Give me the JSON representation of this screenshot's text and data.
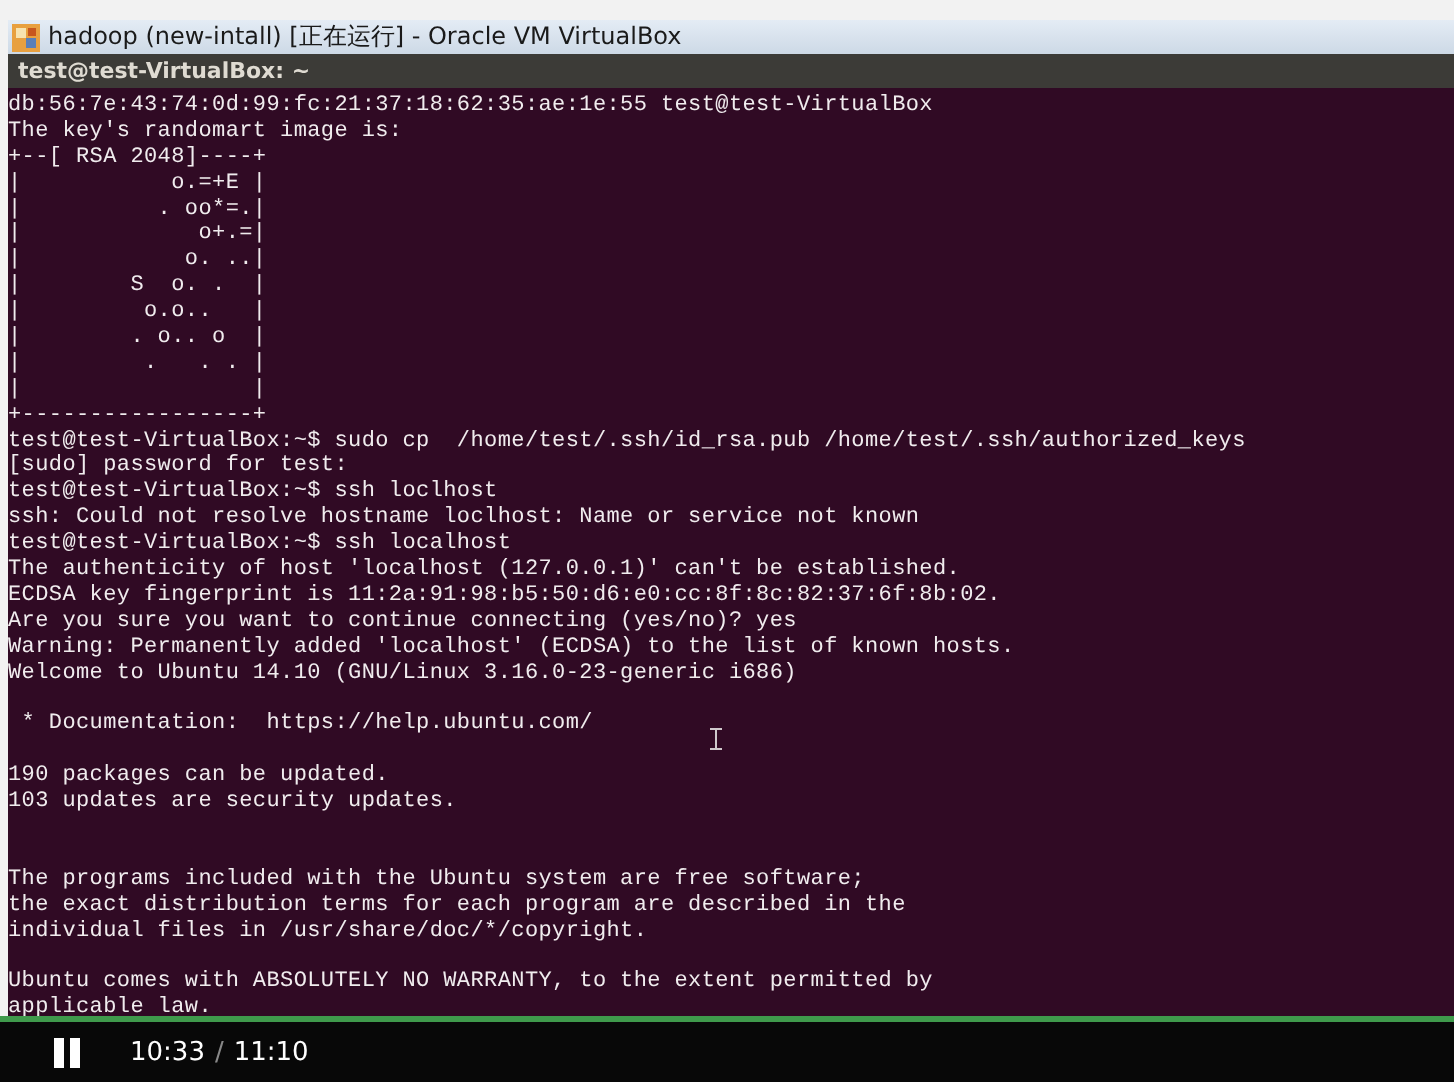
{
  "window": {
    "title": "hadoop (new-intall) [正在运行] - Oracle VM VirtualBox"
  },
  "terminal": {
    "title": "test@test-VirtualBox: ~",
    "lines": [
      {
        "text": "db:56:7e:43:74:0d:99:fc:21:37:18:62:35:ae:1e:55 test@test-VirtualBox"
      },
      {
        "text": "The key's randomart image is:"
      },
      {
        "text": "+--[ RSA 2048]----+"
      },
      {
        "text": "|           o.=+E |"
      },
      {
        "text": "|          . oo*=.|"
      },
      {
        "text": "|             o+.=|"
      },
      {
        "text": "|            o. ..|"
      },
      {
        "text": "|        S  o. .  |"
      },
      {
        "text": "|         o.o..   |"
      },
      {
        "text": "|        . o.. o  |"
      },
      {
        "text": "|         .   . . |"
      },
      {
        "text": "|                 |"
      },
      {
        "text": "+-----------------+"
      },
      {
        "text": "test@test-VirtualBox:~$ sudo cp  /home/test/.ssh/id_rsa.pub /home/test/.ssh/authorized_keys"
      },
      {
        "text": "[sudo] password for test:"
      },
      {
        "text": "test@test-VirtualBox:~$ ssh loclhost"
      },
      {
        "text": "ssh: Could not resolve hostname loclhost: Name or service not known"
      },
      {
        "text": "test@test-VirtualBox:~$ ssh localhost"
      },
      {
        "text": "The authenticity of host 'localhost (127.0.0.1)' can't be established."
      },
      {
        "text": "ECDSA key fingerprint is 11:2a:91:98:b5:50:d6:e0:cc:8f:8c:82:37:6f:8b:02."
      },
      {
        "text": "Are you sure you want to continue connecting (yes/no)? yes"
      },
      {
        "text": "Warning: Permanently added 'localhost' (ECDSA) to the list of known hosts."
      },
      {
        "text": "Welcome to Ubuntu 14.10 (GNU/Linux 3.16.0-23-generic i686)"
      },
      {
        "kind": "blank"
      },
      {
        "text": " * Documentation:  https://help.ubuntu.com/"
      },
      {
        "kind": "blank"
      },
      {
        "text": "190 packages can be updated."
      },
      {
        "text": "103 updates are security updates."
      },
      {
        "kind": "blank"
      },
      {
        "kind": "blank"
      },
      {
        "text": "The programs included with the Ubuntu system are free software;"
      },
      {
        "text": "the exact distribution terms for each program are described in the"
      },
      {
        "text": "individual files in /usr/share/doc/*/copyright."
      },
      {
        "kind": "blank"
      },
      {
        "text": "Ubuntu comes with ABSOLUTELY NO WARRANTY, to the extent permitted by"
      },
      {
        "text": "applicable law."
      }
    ]
  },
  "player": {
    "playing": true,
    "progress": {
      "level": 1.0
    },
    "elapsed": "10:33",
    "separator": "/",
    "duration": "11:10"
  }
}
